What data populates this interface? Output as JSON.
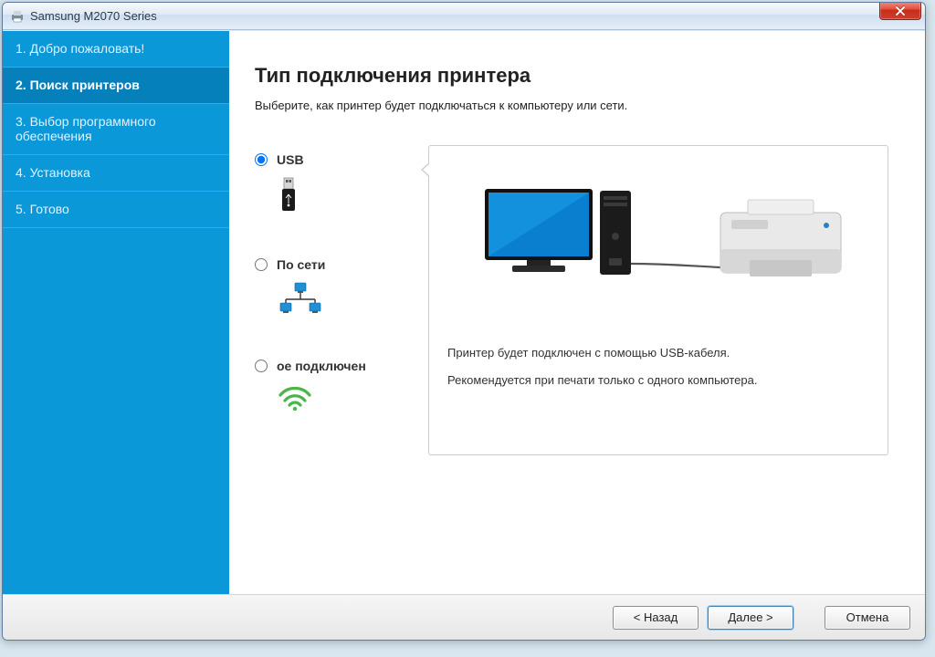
{
  "window": {
    "title": "Samsung M2070 Series"
  },
  "sidebar": {
    "steps": [
      {
        "label": "1. Добро пожаловать!"
      },
      {
        "label": "2. Поиск принтеров"
      },
      {
        "label": "3. Выбор программного обеспечения"
      },
      {
        "label": "4. Установка"
      },
      {
        "label": "5. Готово"
      }
    ],
    "active_index": 1
  },
  "page": {
    "heading": "Тип подключения принтера",
    "subheading": "Выберите, как принтер будет подключаться к компьютеру или сети."
  },
  "options": {
    "usb": {
      "label": "USB"
    },
    "network": {
      "label": "По сети"
    },
    "wireless": {
      "label": "ое подключен"
    },
    "selected": "usb"
  },
  "preview": {
    "line1": "Принтер будет подключен с помощью USB-кабеля.",
    "line2": "Рекомендуется при печати только с одного компьютера."
  },
  "footer": {
    "back": "< Назад",
    "next": "Далее >",
    "cancel": "Отмена"
  }
}
